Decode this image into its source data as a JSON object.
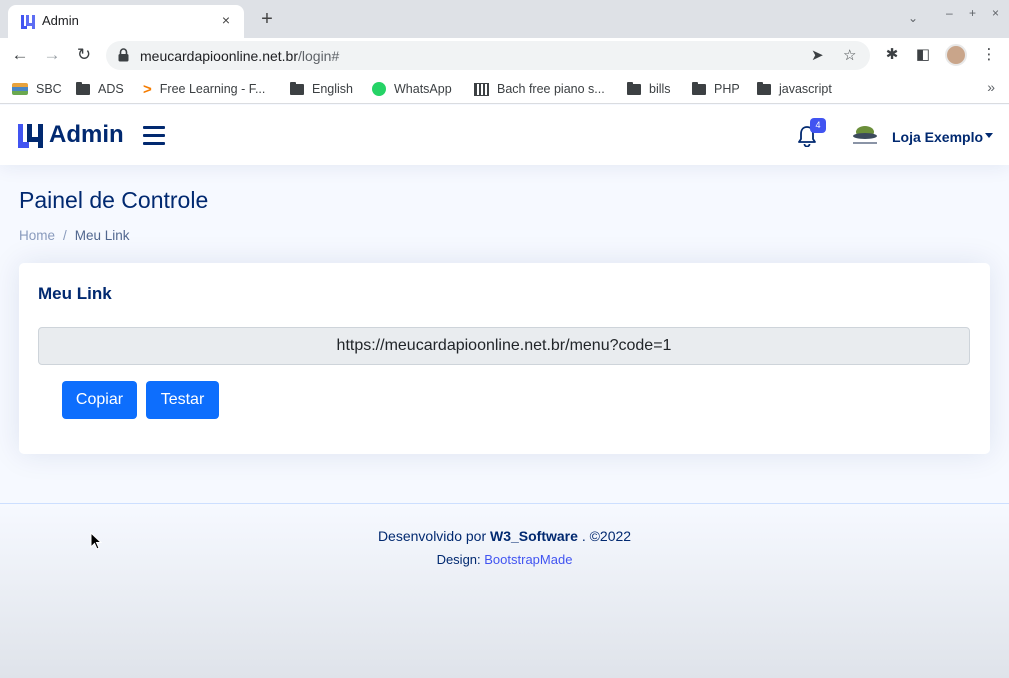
{
  "browser": {
    "tab": {
      "title": "Admin",
      "close_icon": "×"
    },
    "new_tab_icon": "+",
    "tab_search_icon": "⌄",
    "window_controls": [
      "–",
      "+",
      "×"
    ],
    "url": {
      "host": "meucardapioonline.net.br",
      "path": "/login#"
    },
    "bookmarks": [
      "SBC",
      "ADS",
      "Free Learning - F...",
      "English",
      "WhatsApp",
      "Bach free piano s...",
      "bills",
      "PHP",
      "javascript"
    ],
    "bookmarks_more": "»"
  },
  "header": {
    "logo_text": "Admin",
    "notification_count": "4",
    "store_name": "Loja Exemplo"
  },
  "page": {
    "title": "Painel de Controle",
    "breadcrumb": {
      "home": "Home",
      "separator": "/",
      "current": "Meu Link"
    }
  },
  "card": {
    "title": "Meu Link",
    "link_value": "https://meucardapioonline.net.br/menu?code=1",
    "copy_label": "Copiar",
    "test_label": "Testar"
  },
  "footer": {
    "developed_by": "Desenvolvido por",
    "company": "W3_Software",
    "copyright": ". ©2022",
    "design_label": "Design:",
    "design_link": "BootstrapMade"
  },
  "colors": {
    "brand": "#012970",
    "accent": "#4154f1",
    "primary_button": "#0d6efd",
    "page_bg": "#f6f9ff"
  }
}
